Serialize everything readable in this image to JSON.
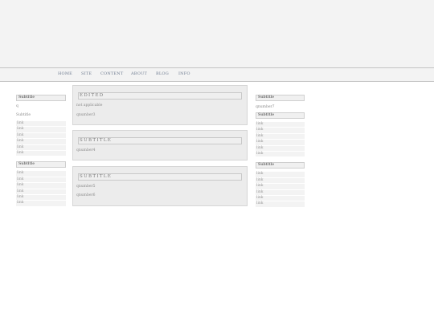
{
  "nav": {
    "items": [
      "HOME",
      "SITE",
      "CONTENT",
      "ABOUT",
      "BLOG",
      "INFO"
    ]
  },
  "left_sidebar": {
    "box1": {
      "title": "Subtitle",
      "lines": [
        "q",
        "Subtitle"
      ],
      "links": [
        "link",
        "link",
        "link",
        "link",
        "link",
        "link"
      ]
    },
    "box2": {
      "title": "Subtitle",
      "links": [
        "link",
        "link",
        "link",
        "link",
        "link",
        "link"
      ]
    }
  },
  "main": {
    "panels": [
      {
        "title": "EDITED",
        "lines": [
          "not applicable",
          "qnumber3"
        ]
      },
      {
        "title": "SUBTITLE",
        "lines": [
          "qnumber4"
        ]
      },
      {
        "title": "SUBTITLE",
        "lines": [
          "qnumber5",
          "qnumber6"
        ]
      }
    ]
  },
  "right_sidebar": {
    "box1": {
      "title": "Subtitle",
      "text": "qnumber7"
    },
    "box2": {
      "title": "Subtitle",
      "links": [
        "link",
        "link",
        "link",
        "link",
        "link",
        "link"
      ]
    },
    "box3": {
      "title": "Subtitle",
      "links": [
        "link",
        "link",
        "link",
        "link",
        "link",
        "link"
      ]
    }
  }
}
